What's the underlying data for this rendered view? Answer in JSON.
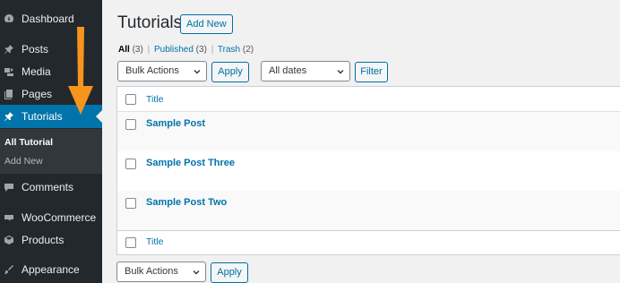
{
  "sidebar": {
    "items": [
      {
        "label": "Dashboard",
        "icon": "dashboard-icon"
      },
      {
        "label": "Posts",
        "icon": "pin-icon"
      },
      {
        "label": "Media",
        "icon": "media-icon"
      },
      {
        "label": "Pages",
        "icon": "pages-icon"
      },
      {
        "label": "Tutorials",
        "icon": "pin-icon"
      },
      {
        "label": "Comments",
        "icon": "comment-icon"
      },
      {
        "label": "WooCommerce",
        "icon": "woo-icon"
      },
      {
        "label": "Products",
        "icon": "products-icon"
      },
      {
        "label": "Appearance",
        "icon": "brush-icon"
      }
    ],
    "submenu": [
      "All Tutorial",
      "Add New"
    ]
  },
  "header": {
    "title": "Tutorials",
    "add_new": "Add New"
  },
  "filters": {
    "all": "All",
    "all_count": "(3)",
    "published": "Published",
    "published_count": "(3)",
    "trash": "Trash",
    "trash_count": "(2)",
    "sep": "|"
  },
  "toolbar": {
    "bulk_actions": "Bulk Actions",
    "apply": "Apply",
    "dates": "All dates",
    "filter": "Filter"
  },
  "table": {
    "column_title": "Title",
    "rows": [
      "Sample Post",
      "Sample Post Three",
      "Sample Post Two"
    ]
  },
  "colors": {
    "sidebar_bg": "#23282d",
    "active_bg": "#0073aa",
    "link": "#0073aa",
    "annotation_arrow": "#f7941d"
  }
}
